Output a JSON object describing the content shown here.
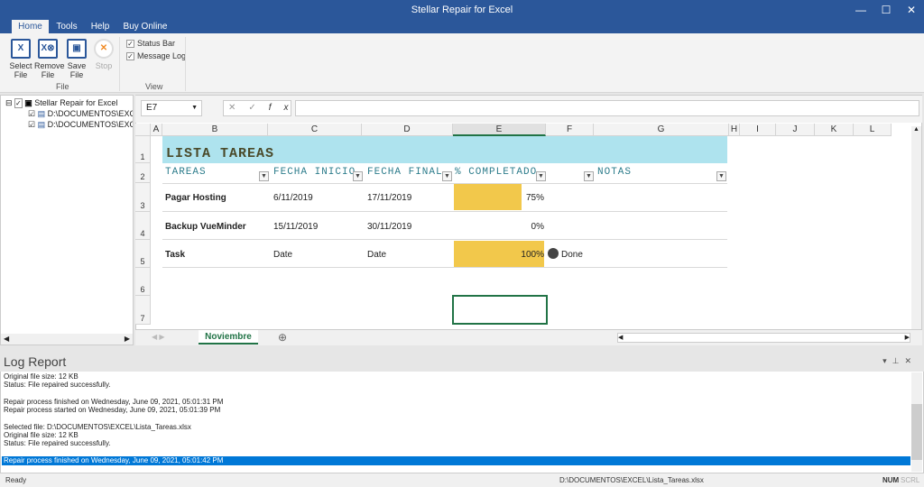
{
  "window": {
    "title": "Stellar Repair for Excel"
  },
  "menu_tabs": [
    "Home",
    "Tools",
    "Help",
    "Buy Online"
  ],
  "ribbon": {
    "file_group": "File",
    "view_group": "View",
    "buttons": [
      {
        "l1": "Select",
        "l2": "File"
      },
      {
        "l1": "Remove",
        "l2": "File"
      },
      {
        "l1": "Save",
        "l2": "File"
      },
      {
        "l1": "Stop",
        "l2": ""
      }
    ],
    "checks": [
      {
        "label": "Status Bar",
        "checked": true
      },
      {
        "label": "Message Log",
        "checked": true
      }
    ]
  },
  "tree": {
    "root": "Stellar Repair for Excel",
    "items": [
      "D:\\DOCUMENTOS\\EXCEL",
      "D:\\DOCUMENTOS\\EXCEL"
    ]
  },
  "formula": {
    "name_box": "E7",
    "value": ""
  },
  "columns": [
    "A",
    "B",
    "C",
    "D",
    "E",
    "F",
    "G",
    "H",
    "I",
    "J",
    "K",
    "L"
  ],
  "rows": [
    "1",
    "2",
    "3",
    "4",
    "5",
    "6",
    "7"
  ],
  "sheet": {
    "title": "LISTA TAREAS",
    "headers": [
      "TAREAS",
      "FECHA INICIO",
      "FECHA FINAL",
      "% COMPLETADO",
      "",
      "NOTAS"
    ],
    "data": [
      {
        "task": "Pagar Hosting",
        "start": "6/11/2019",
        "end": "17/11/2019",
        "pct": "75%",
        "pct_value": 75,
        "status": ""
      },
      {
        "task": "Backup VueMinder",
        "start": "15/11/2019",
        "end": "30/11/2019",
        "pct": "0%",
        "pct_value": 0,
        "status": ""
      },
      {
        "task": "Task",
        "start": "Date",
        "end": "Date",
        "pct": "100%",
        "pct_value": 100,
        "status": "Done"
      }
    ],
    "bar_color": "#f2c84b",
    "title_bg": "#aee3ee"
  },
  "sheet_tabs": [
    "Noviembre"
  ],
  "log": {
    "title": "Log Report",
    "lines": [
      "Original file size: 12 KB",
      "Status: File repaired successfully.",
      "",
      "Repair process finished on Wednesday, June 09, 2021, 05:01:31 PM",
      "Repair process started on  Wednesday, June 09, 2021, 05:01:39 PM",
      "",
      "Selected file: D:\\DOCUMENTOS\\EXCEL\\Lista_Tareas.xlsx",
      "Original file size: 12 KB",
      "Status: File repaired successfully.",
      ""
    ],
    "selected_line": "Repair process finished on Wednesday, June 09, 2021, 05:01:42 PM"
  },
  "status": {
    "text": "Ready",
    "path": "D:\\DOCUMENTOS\\EXCEL\\Lista_Tareas.xlsx",
    "num": "NUM",
    "scrl": "SCRL"
  }
}
